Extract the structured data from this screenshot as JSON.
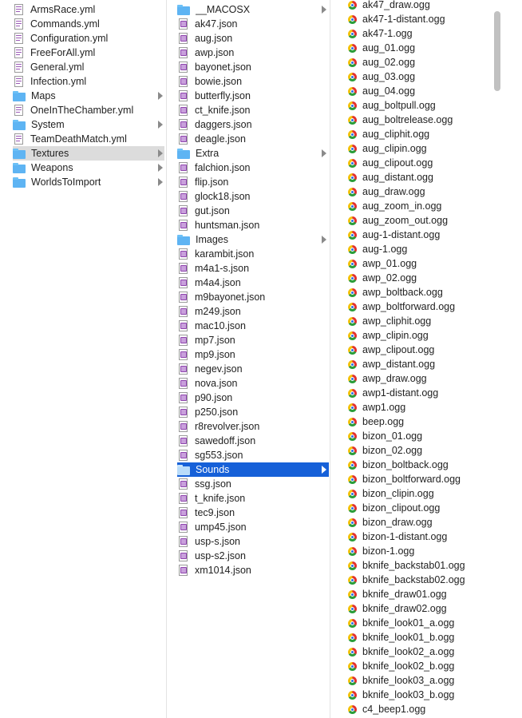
{
  "columns": {
    "left": {
      "items": [
        {
          "label": "ArmsRace.yml",
          "kind": "file"
        },
        {
          "label": "Commands.yml",
          "kind": "file"
        },
        {
          "label": "Configuration.yml",
          "kind": "file"
        },
        {
          "label": "FreeForAll.yml",
          "kind": "file"
        },
        {
          "label": "General.yml",
          "kind": "file"
        },
        {
          "label": "Infection.yml",
          "kind": "file"
        },
        {
          "label": "Maps",
          "kind": "folder"
        },
        {
          "label": "OneInTheChamber.yml",
          "kind": "file"
        },
        {
          "label": "System",
          "kind": "folder"
        },
        {
          "label": "TeamDeathMatch.yml",
          "kind": "file"
        },
        {
          "label": "Textures",
          "kind": "folder",
          "selected": "gray"
        },
        {
          "label": "Weapons",
          "kind": "folder"
        },
        {
          "label": "WorldsToImport",
          "kind": "folder"
        }
      ]
    },
    "middle": {
      "items": [
        {
          "label": "__MACOSX",
          "kind": "folder"
        },
        {
          "label": "ak47.json",
          "kind": "json"
        },
        {
          "label": "aug.json",
          "kind": "json"
        },
        {
          "label": "awp.json",
          "kind": "json"
        },
        {
          "label": "bayonet.json",
          "kind": "json"
        },
        {
          "label": "bowie.json",
          "kind": "json"
        },
        {
          "label": "butterfly.json",
          "kind": "json"
        },
        {
          "label": "ct_knife.json",
          "kind": "json"
        },
        {
          "label": "daggers.json",
          "kind": "json"
        },
        {
          "label": "deagle.json",
          "kind": "json"
        },
        {
          "label": "Extra",
          "kind": "folder"
        },
        {
          "label": "falchion.json",
          "kind": "json"
        },
        {
          "label": "flip.json",
          "kind": "json"
        },
        {
          "label": "glock18.json",
          "kind": "json"
        },
        {
          "label": "gut.json",
          "kind": "json"
        },
        {
          "label": "huntsman.json",
          "kind": "json"
        },
        {
          "label": "Images",
          "kind": "folder"
        },
        {
          "label": "karambit.json",
          "kind": "json"
        },
        {
          "label": "m4a1-s.json",
          "kind": "json"
        },
        {
          "label": "m4a4.json",
          "kind": "json"
        },
        {
          "label": "m9bayonet.json",
          "kind": "json"
        },
        {
          "label": "m249.json",
          "kind": "json"
        },
        {
          "label": "mac10.json",
          "kind": "json"
        },
        {
          "label": "mp7.json",
          "kind": "json"
        },
        {
          "label": "mp9.json",
          "kind": "json"
        },
        {
          "label": "negev.json",
          "kind": "json"
        },
        {
          "label": "nova.json",
          "kind": "json"
        },
        {
          "label": "p90.json",
          "kind": "json"
        },
        {
          "label": "p250.json",
          "kind": "json"
        },
        {
          "label": "r8revolver.json",
          "kind": "json"
        },
        {
          "label": "sawedoff.json",
          "kind": "json"
        },
        {
          "label": "sg553.json",
          "kind": "json"
        },
        {
          "label": "Sounds",
          "kind": "folder",
          "selected": "blue"
        },
        {
          "label": "ssg.json",
          "kind": "json"
        },
        {
          "label": "t_knife.json",
          "kind": "json"
        },
        {
          "label": "tec9.json",
          "kind": "json"
        },
        {
          "label": "ump45.json",
          "kind": "json"
        },
        {
          "label": "usp-s.json",
          "kind": "json"
        },
        {
          "label": "usp-s2.json",
          "kind": "json"
        },
        {
          "label": "xm1014.json",
          "kind": "json"
        }
      ]
    },
    "right": {
      "items": [
        "ak47_draw.ogg",
        "ak47-1-distant.ogg",
        "ak47-1.ogg",
        "aug_01.ogg",
        "aug_02.ogg",
        "aug_03.ogg",
        "aug_04.ogg",
        "aug_boltpull.ogg",
        "aug_boltrelease.ogg",
        "aug_cliphit.ogg",
        "aug_clipin.ogg",
        "aug_clipout.ogg",
        "aug_distant.ogg",
        "aug_draw.ogg",
        "aug_zoom_in.ogg",
        "aug_zoom_out.ogg",
        "aug-1-distant.ogg",
        "aug-1.ogg",
        "awp_01.ogg",
        "awp_02.ogg",
        "awp_boltback.ogg",
        "awp_boltforward.ogg",
        "awp_cliphit.ogg",
        "awp_clipin.ogg",
        "awp_clipout.ogg",
        "awp_distant.ogg",
        "awp_draw.ogg",
        "awp1-distant.ogg",
        "awp1.ogg",
        "beep.ogg",
        "bizon_01.ogg",
        "bizon_02.ogg",
        "bizon_boltback.ogg",
        "bizon_boltforward.ogg",
        "bizon_clipin.ogg",
        "bizon_clipout.ogg",
        "bizon_draw.ogg",
        "bizon-1-distant.ogg",
        "bizon-1.ogg",
        "bknife_backstab01.ogg",
        "bknife_backstab02.ogg",
        "bknife_draw01.ogg",
        "bknife_draw02.ogg",
        "bknife_look01_a.ogg",
        "bknife_look01_b.ogg",
        "bknife_look02_a.ogg",
        "bknife_look02_b.ogg",
        "bknife_look03_a.ogg",
        "bknife_look03_b.ogg",
        "c4_beep1.ogg"
      ]
    }
  }
}
